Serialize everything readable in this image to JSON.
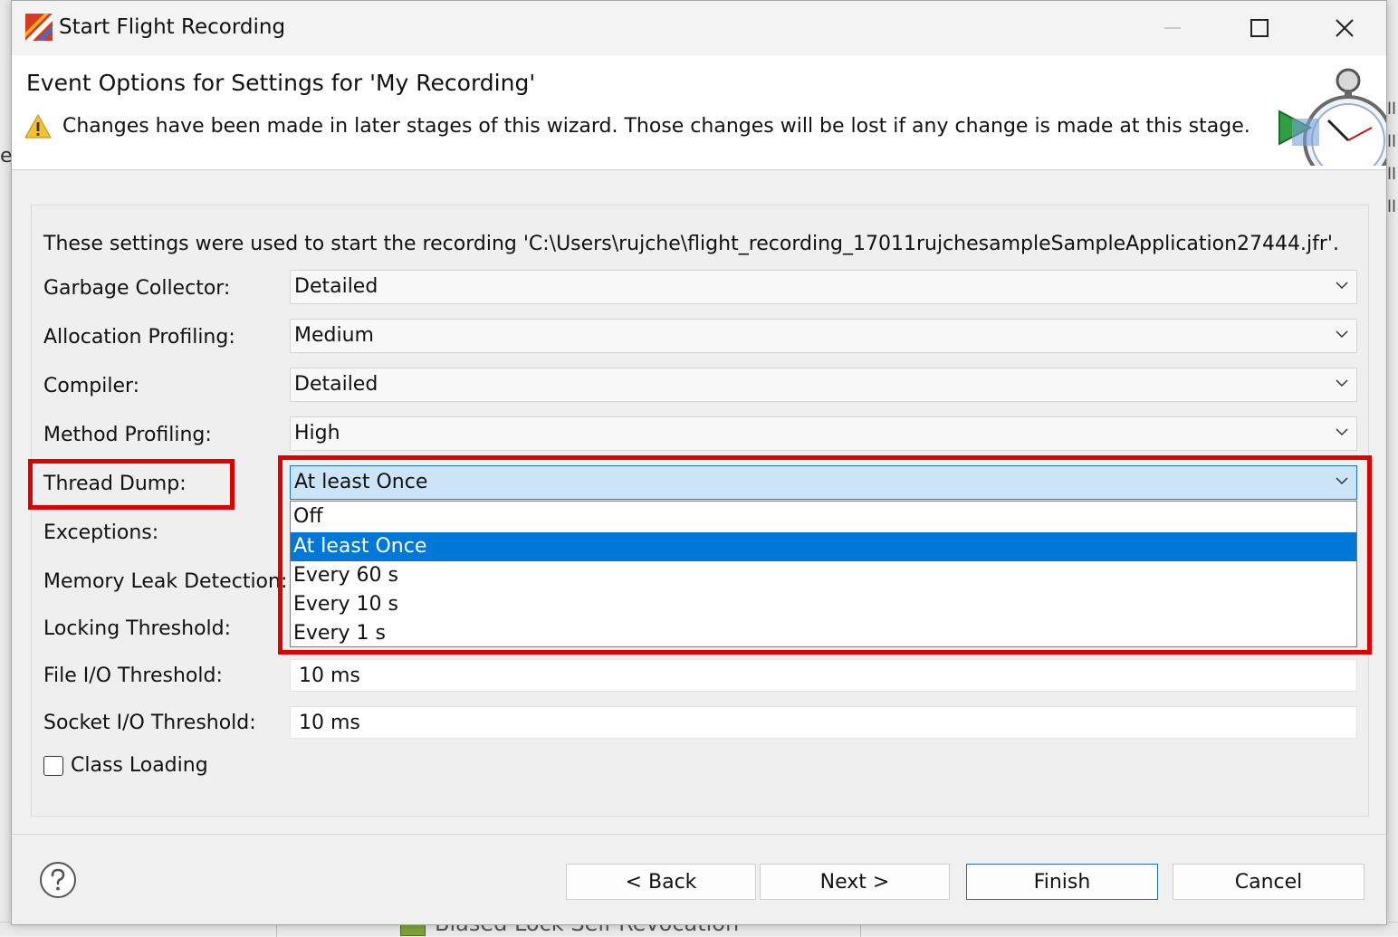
{
  "window": {
    "title": "Start Flight Recording"
  },
  "header": {
    "title": "Event Options for Settings for 'My Recording'",
    "warning": "Changes have been made in later stages of this wizard. Those changes will be lost if any change is made at this stage."
  },
  "info": "These settings were used to start the recording 'C:\\Users\\rujche\\flight_recording_17011rujchesampleSampleApplication27444.jfr'.",
  "settings": {
    "garbage_collector": {
      "label": "Garbage Collector:",
      "value": "Detailed"
    },
    "allocation_profiling": {
      "label": "Allocation Profiling:",
      "value": "Medium"
    },
    "compiler": {
      "label": "Compiler:",
      "value": "Detailed"
    },
    "method_profiling": {
      "label": "Method Profiling:",
      "value": "High"
    },
    "thread_dump": {
      "label": "Thread Dump:",
      "value": "At least Once",
      "options": [
        "Off",
        "At least Once",
        "Every 60 s",
        "Every 10 s",
        "Every 1 s"
      ],
      "selected_index": 1
    },
    "exceptions": {
      "label": "Exceptions:"
    },
    "memory_leak_detection": {
      "label": "Memory Leak Detection:"
    },
    "locking_threshold": {
      "label": "Locking Threshold:"
    },
    "file_io_threshold": {
      "label": "File I/O Threshold:",
      "value": "10 ms"
    },
    "socket_io_threshold": {
      "label": "Socket I/O Threshold:",
      "value": "10 ms"
    },
    "class_loading": {
      "label": "Class Loading",
      "checked": false
    }
  },
  "buttons": {
    "back": "< Back",
    "next": "Next >",
    "finish": "Finish",
    "cancel": "Cancel"
  },
  "icons": {
    "app": "flight-recorder-icon",
    "warning": "warning-icon",
    "help": "help-icon",
    "header_graphic": "stopwatch-icon"
  },
  "colors": {
    "selection": "#0078d7",
    "highlight_box": "#e00000",
    "active_combo": "#cce4f7"
  },
  "background": {
    "left_fragment": "e",
    "bottom_fragment": "Biased Lock Self Revocation"
  }
}
